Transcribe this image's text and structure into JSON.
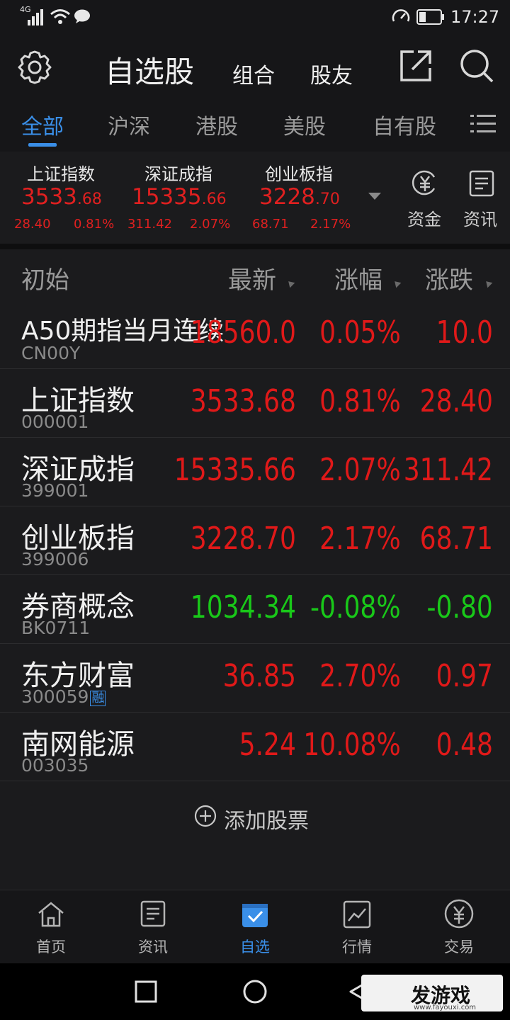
{
  "status_bar": {
    "network": "4G",
    "time": "17:27"
  },
  "header": {
    "title": "自选股",
    "combo": "组合",
    "friends": "股友"
  },
  "tabs": [
    {
      "label": "全部",
      "active": true
    },
    {
      "label": "沪深"
    },
    {
      "label": "港股"
    },
    {
      "label": "美股"
    },
    {
      "label": "自有股"
    }
  ],
  "indices": [
    {
      "name": "上证指数",
      "value_main": "3533",
      "value_dec": ".68",
      "change": "28.40",
      "percent": "0.81%"
    },
    {
      "name": "深证成指",
      "value_main": "15335",
      "value_dec": ".66",
      "change": "311.42",
      "percent": "2.07%"
    },
    {
      "name": "创业板指",
      "value_main": "3228",
      "value_dec": ".70",
      "change": "68.71",
      "percent": "2.17%"
    }
  ],
  "tools": {
    "funds": "资金",
    "news": "资讯"
  },
  "list_header": {
    "initial": "初始",
    "latest": "最新",
    "change_pct": "涨幅",
    "change": "涨跌"
  },
  "rows": [
    {
      "name": "A50期指当月连续",
      "code": "CN00Y",
      "latest": "18560.0",
      "pct": "0.05%",
      "chg": "10.0",
      "dir": "up"
    },
    {
      "name": "上证指数",
      "code": "000001",
      "latest": "3533.68",
      "pct": "0.81%",
      "chg": "28.40",
      "dir": "up"
    },
    {
      "name": "深证成指",
      "code": "399001",
      "latest": "15335.66",
      "pct": "2.07%",
      "chg": "311.42",
      "dir": "up"
    },
    {
      "name": "创业板指",
      "code": "399006",
      "latest": "3228.70",
      "pct": "2.17%",
      "chg": "68.71",
      "dir": "up"
    },
    {
      "name": "券商概念",
      "code": "BK0711",
      "latest": "1034.34",
      "pct": "-0.08%",
      "chg": "-0.80",
      "dir": "down"
    },
    {
      "name": "东方财富",
      "code": "300059",
      "badge": "融",
      "latest": "36.85",
      "pct": "2.70%",
      "chg": "0.97",
      "dir": "up"
    },
    {
      "name": "南网能源",
      "code": "003035",
      "latest": "5.24",
      "pct": "10.08%",
      "chg": "0.48",
      "dir": "up"
    }
  ],
  "add_stock": "添加股票",
  "bottom_nav": [
    {
      "label": "首页"
    },
    {
      "label": "资讯"
    },
    {
      "label": "自选",
      "active": true
    },
    {
      "label": "行情"
    },
    {
      "label": "交易"
    }
  ],
  "watermark": {
    "text": "发游戏",
    "url": "www.fayouxi.com"
  },
  "colors": {
    "up": "#e01919",
    "down": "#19c819",
    "accent": "#3a8fe8",
    "background": "#1b1b1d"
  }
}
